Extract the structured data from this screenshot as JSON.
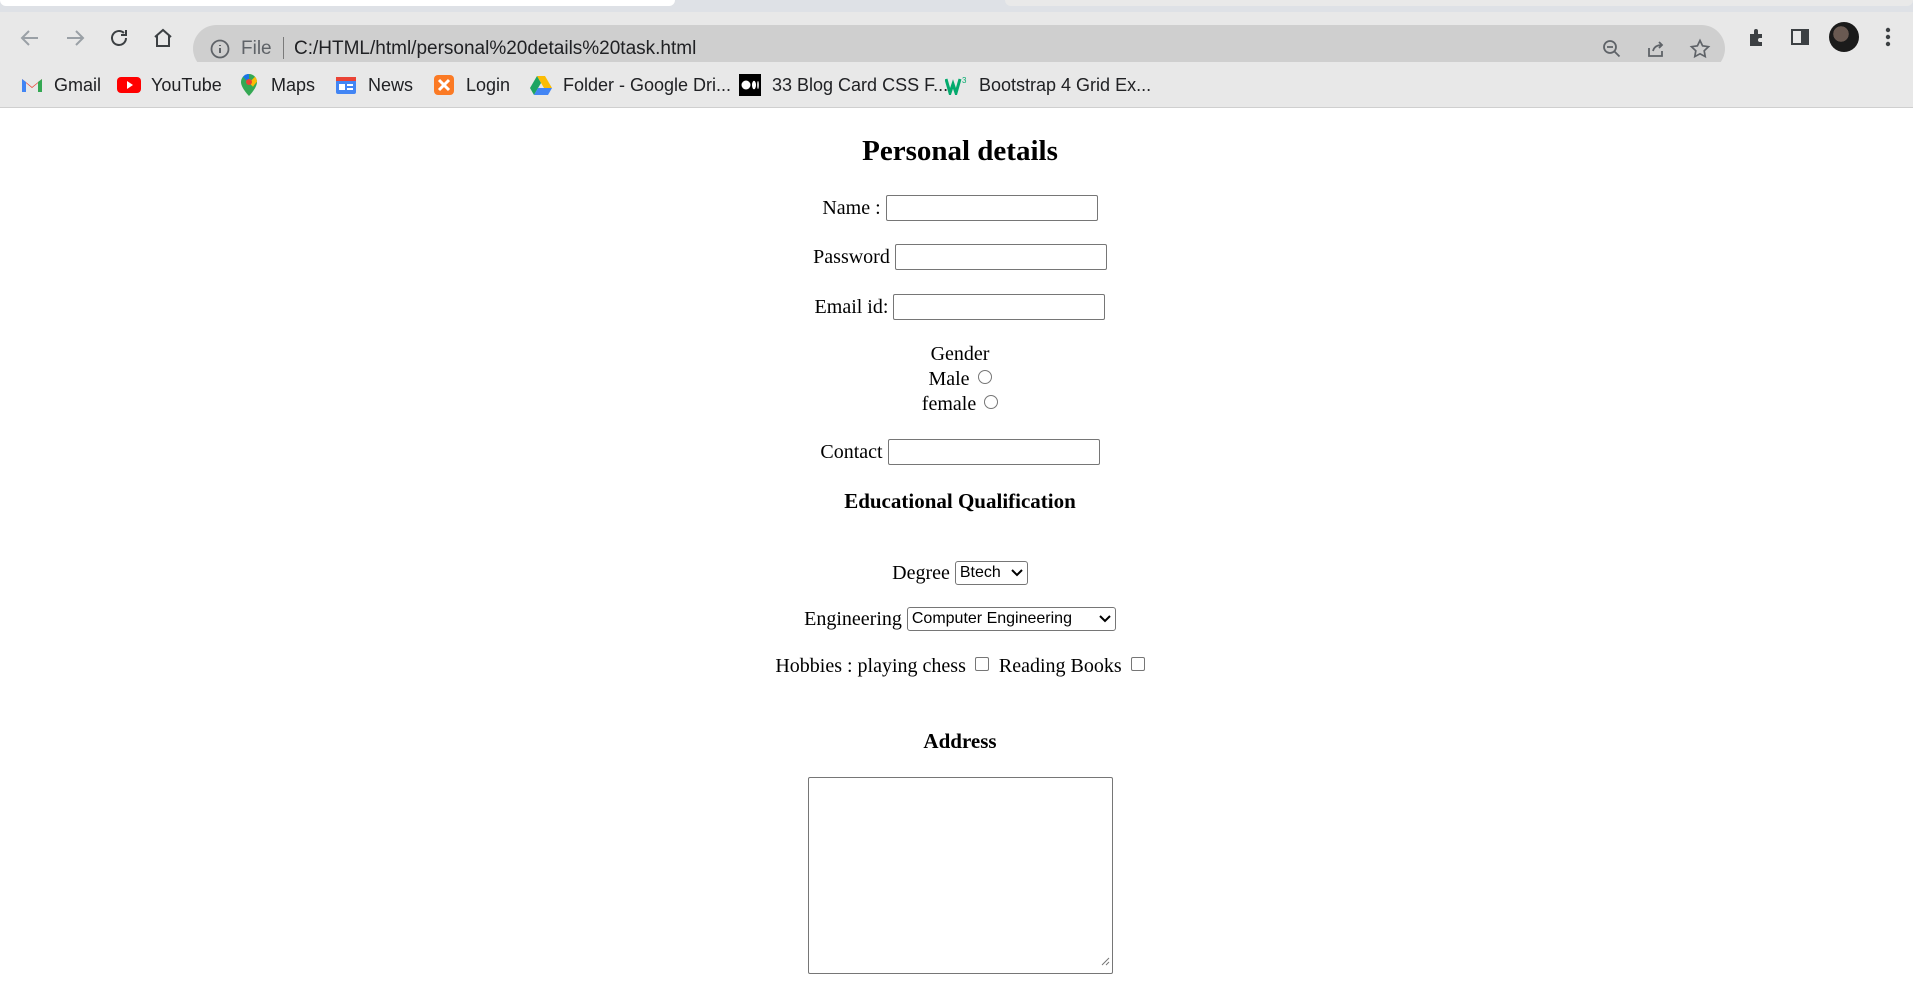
{
  "browser": {
    "address": {
      "scheme_label": "File",
      "url": "C:/HTML/html/personal%20details%20task.html"
    },
    "bookmarks": [
      {
        "label": "Gmail",
        "icon": "gmail-icon"
      },
      {
        "label": "YouTube",
        "icon": "youtube-icon"
      },
      {
        "label": "Maps",
        "icon": "maps-icon"
      },
      {
        "label": "News",
        "icon": "news-icon"
      },
      {
        "label": "Login",
        "icon": "xampp-icon"
      },
      {
        "label": "Folder - Google Dri...",
        "icon": "google-drive-icon"
      },
      {
        "label": "33 Blog Card CSS F...",
        "icon": "medium-icon"
      },
      {
        "label": "Bootstrap 4 Grid Ex...",
        "icon": "w3-icon"
      }
    ]
  },
  "form": {
    "title": "Personal details",
    "name_label": "Name :",
    "password_label": "Password",
    "email_label": "Email id:",
    "gender_label": "Gender",
    "male_label": "Male",
    "female_label": "female",
    "contact_label": "Contact",
    "education_heading": "Educational Qualification",
    "degree_label": "Degree",
    "degree_value": "Btech",
    "engineering_label": "Engineering",
    "engineering_value": "Computer Engineering",
    "hobbies_label": "Hobbies : playing chess",
    "reading_label": "Reading Books",
    "address_heading": "Address"
  }
}
